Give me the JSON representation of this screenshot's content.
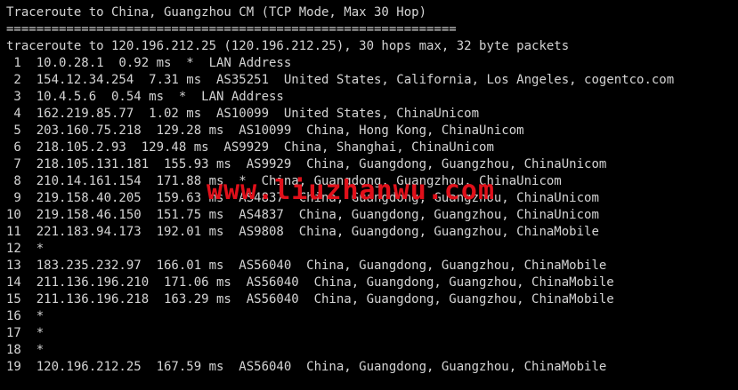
{
  "terminal": {
    "header": {
      "title": "Traceroute to China, Guangzhou CM (TCP Mode, Max 30 Hop)",
      "separator": "============================================================",
      "command_output": "traceroute to 120.196.212.25 (120.196.212.25), 30 hops max, 32 byte packets"
    },
    "hops": [
      " 1  10.0.28.1  0.92 ms  *  LAN Address",
      " 2  154.12.34.254  7.31 ms  AS35251  United States, California, Los Angeles, cogentco.com",
      " 3  10.4.5.6  0.54 ms  *  LAN Address",
      " 4  162.219.85.77  1.02 ms  AS10099  United States, ChinaUnicom",
      " 5  203.160.75.218  129.28 ms  AS10099  China, Hong Kong, ChinaUnicom",
      " 6  218.105.2.93  129.48 ms  AS9929  China, Shanghai, ChinaUnicom",
      " 7  218.105.131.181  155.93 ms  AS9929  China, Guangdong, Guangzhou, ChinaUnicom",
      " 8  210.14.161.154  171.88 ms  *  China, Guangdong, Guangzhou, ChinaUnicom",
      " 9  219.158.40.205  159.63 ms  AS4837  China, Guangdong, Guangzhou, ChinaUnicom",
      "10  219.158.46.150  151.75 ms  AS4837  China, Guangdong, Guangzhou, ChinaUnicom",
      "11  221.183.94.173  192.01 ms  AS9808  China, Guangdong, Guangzhou, ChinaMobile",
      "12  *",
      "13  183.235.232.97  166.01 ms  AS56040  China, Guangdong, Guangzhou, ChinaMobile",
      "14  211.136.196.210  171.06 ms  AS56040  China, Guangdong, Guangzhou, ChinaMobile",
      "15  211.136.196.218  163.29 ms  AS56040  China, Guangdong, Guangzhou, ChinaMobile",
      "16  *",
      "17  *",
      "18  *",
      "19  120.196.212.25  167.59 ms  AS56040  China, Guangdong, Guangzhou, ChinaMobile"
    ]
  },
  "watermark": {
    "text": "www.liuzhanwu.com",
    "color": "#e0101a"
  },
  "colors": {
    "background": "#000000",
    "text": "#d4d4d4"
  }
}
